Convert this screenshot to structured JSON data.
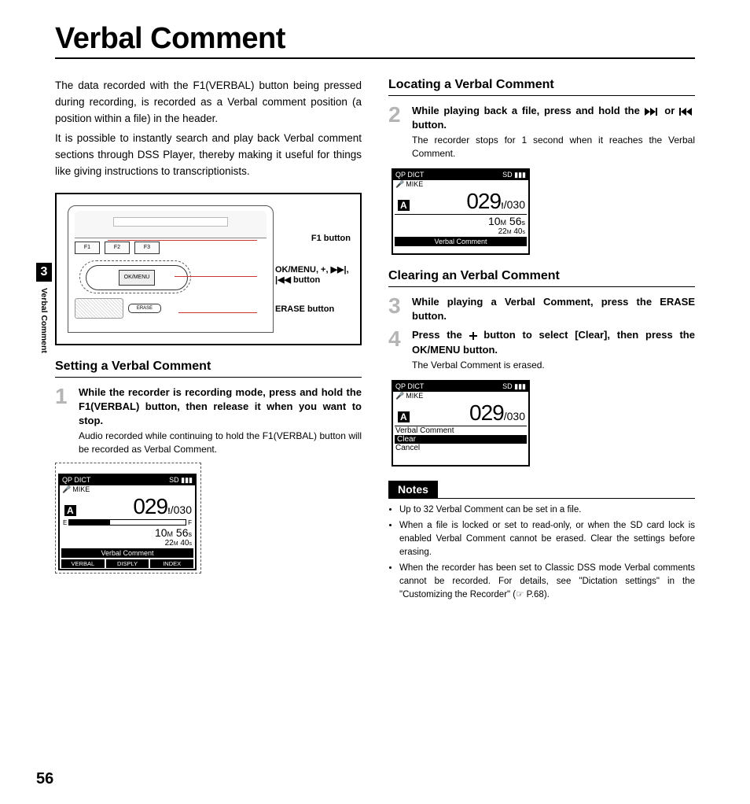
{
  "page_title": "Verbal Comment",
  "side_tab": {
    "chapter": "3",
    "label": "Verbal Comment"
  },
  "page_number": "56",
  "intro": {
    "p1": "The data recorded with the F1(VERBAL) button being pressed during recording, is recorded as a Verbal comment position (a position within a file) in the header.",
    "p2": "It is possible to instantly search and play back Verbal comment sections through DSS Player, thereby making it useful for things like giving instructions to transcriptionists."
  },
  "device_labels": {
    "f1": "F1 button",
    "okmenu": "OK/MENU, +, ▶▶|, |◀◀ button",
    "erase": "ERASE button",
    "fkeys": [
      "F1",
      "F2",
      "F3"
    ],
    "ok_center": "OK/MENU",
    "erase_btn": "ERASE"
  },
  "sections": {
    "setting": "Setting a Verbal Comment",
    "locating": "Locating a Verbal Comment",
    "clearing": "Clearing an Verbal Comment"
  },
  "steps": {
    "s1_bold": "While the recorder is recording mode, press and hold the F1(VERBAL) button, then release it when you want to stop.",
    "s1_sub": "Audio recorded while continuing to hold the F1(VERBAL) button will be recorded as Verbal Comment.",
    "s2_bold_a": "While playing back a file, press and hold the ",
    "s2_bold_b": " or ",
    "s2_bold_c": " button.",
    "s2_sub": "The recorder stops for 1 second when it reaches the Verbal Comment.",
    "s3_bold": "While playing a Verbal Comment, press the ERASE button.",
    "s4_bold_a": "Press the ",
    "s4_bold_b": " button to select [Clear], then press the OK/MENU button.",
    "s4_sub": "The Verbal Comment is erased."
  },
  "lcd": {
    "top_left": "QP DICT",
    "sd": "SD",
    "mike": "MIKE",
    "folder": "A",
    "current": "029",
    "total": "030",
    "E": "E",
    "F": "F",
    "min": "10",
    "m": "M",
    "sec": "56",
    "s": "s",
    "rem_min": "22",
    "rem_sec": "40",
    "vc": "Verbal Comment",
    "fn": [
      "VERBAL",
      "DISPLY",
      "INDEX"
    ],
    "clear": "Clear",
    "cancel": "Cancel"
  },
  "notes": {
    "heading": "Notes",
    "items": [
      "Up to 32 Verbal Comment can be set in a file.",
      "When a file is locked or set to read-only, or when the SD card lock is enabled Verbal Comment cannot be erased. Clear the settings before erasing.",
      "When the recorder has been set to Classic DSS mode Verbal comments cannot be recorded.\nFor details, see \"Dictation settings\" in the \"Customizing the Recorder\" (☞ P.68)."
    ]
  }
}
